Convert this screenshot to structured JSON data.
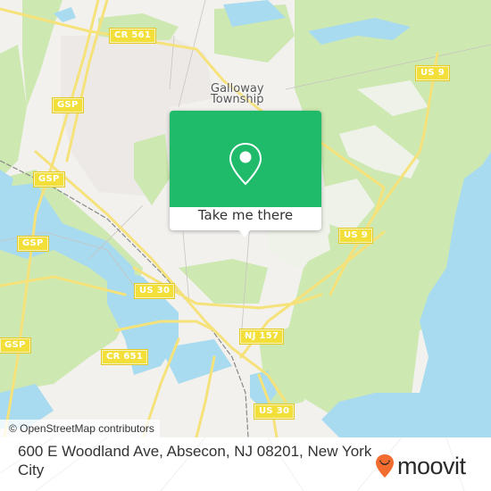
{
  "map": {
    "place_labels": [
      {
        "id": "galloway",
        "lines": [
          "Galloway",
          "Township"
        ]
      }
    ],
    "road_shields": [
      {
        "id": "cr561",
        "label": "CR 561"
      },
      {
        "id": "us9-top",
        "label": "US 9"
      },
      {
        "id": "gsp-top",
        "label": "GSP"
      },
      {
        "id": "gsp-mid1",
        "label": "GSP"
      },
      {
        "id": "gsp-mid2",
        "label": "GSP"
      },
      {
        "id": "us9-mid",
        "label": "US 9"
      },
      {
        "id": "us30-left",
        "label": "US 30"
      },
      {
        "id": "gsp-bottom",
        "label": "GSP"
      },
      {
        "id": "nj157",
        "label": "NJ 157"
      },
      {
        "id": "cr651",
        "label": "CR 651"
      },
      {
        "id": "us30-bottom",
        "label": "US 30"
      }
    ],
    "colors": {
      "land": "#f2f1ee",
      "forest": "#cde8b0",
      "water": "#a8dbef",
      "road": "#f6e27a",
      "urban": "#ede9e6",
      "popup_green": "#1fba6a",
      "brand_orange": "#f26b2f"
    }
  },
  "popup": {
    "icon": "map-pin-icon",
    "button_label": "Take me there"
  },
  "attribution": "© OpenStreetMap contributors",
  "footer": {
    "address": "600 E Woodland Ave, Absecon, NJ 08201, New York City",
    "brand": "moovit",
    "brand_icon": "moovit-smile-pin-icon"
  }
}
